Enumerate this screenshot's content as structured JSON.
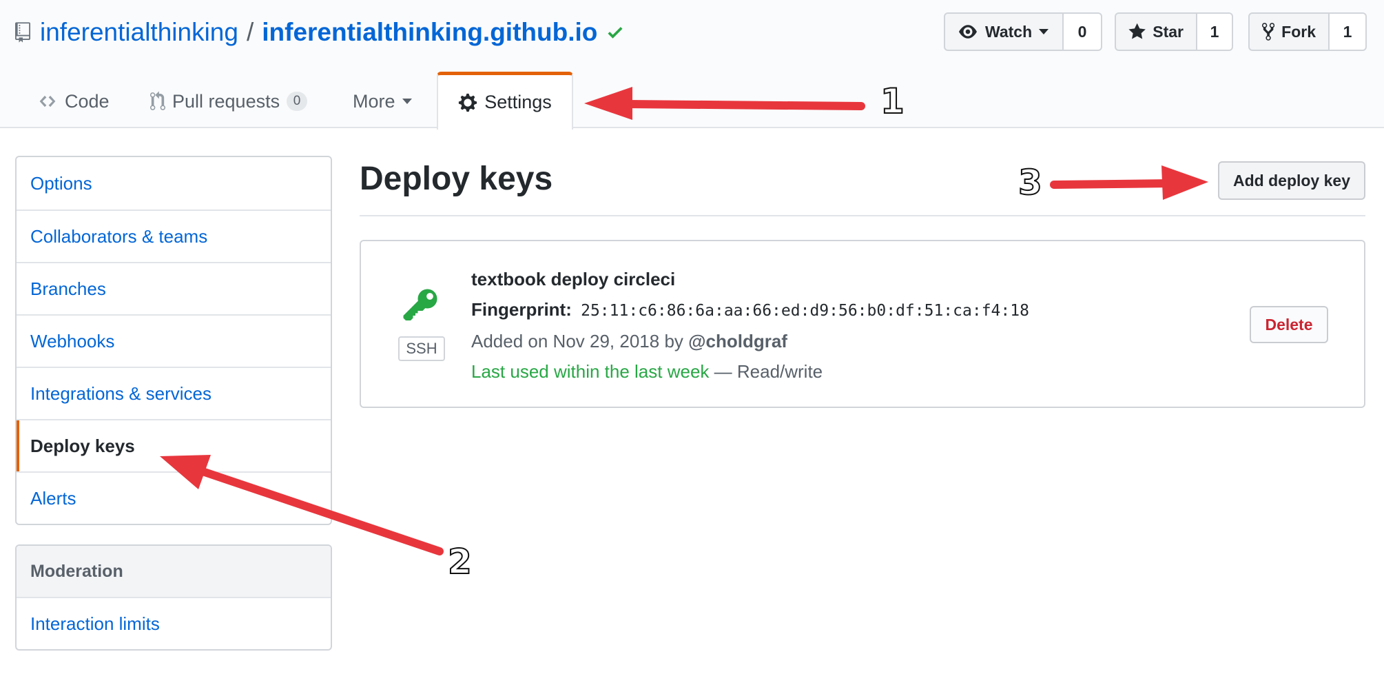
{
  "repo": {
    "owner": "inferentialthinking",
    "separator": "/",
    "name": "inferentialthinking.github.io"
  },
  "actions": {
    "watch": {
      "label": "Watch",
      "count": "0"
    },
    "star": {
      "label": "Star",
      "count": "1"
    },
    "fork": {
      "label": "Fork",
      "count": "1"
    }
  },
  "tabs": {
    "code": "Code",
    "pulls": {
      "label": "Pull requests",
      "count": "0"
    },
    "more": "More",
    "settings": "Settings"
  },
  "sidebar": {
    "items": [
      {
        "label": "Options"
      },
      {
        "label": "Collaborators & teams"
      },
      {
        "label": "Branches"
      },
      {
        "label": "Webhooks"
      },
      {
        "label": "Integrations & services"
      },
      {
        "label": "Deploy keys",
        "selected": true
      },
      {
        "label": "Alerts"
      }
    ],
    "moderation": {
      "heading": "Moderation",
      "items": [
        {
          "label": "Interaction limits"
        }
      ]
    }
  },
  "main": {
    "title": "Deploy keys",
    "add_button": "Add deploy key",
    "key": {
      "type": "SSH",
      "title": "textbook deploy circleci",
      "fingerprint_label": "Fingerprint:",
      "fingerprint": "25:11:c6:86:6a:aa:66:ed:d9:56:b0:df:51:ca:f4:18",
      "added_prefix": "Added on Nov 29, 2018 by",
      "added_user": "@choldgraf",
      "last_used": "Last used within the last week",
      "access": " — Read/write",
      "delete_button": "Delete"
    }
  },
  "annotations": {
    "one": "1",
    "two": "2",
    "three": "3"
  },
  "colors": {
    "link": "#0366d6",
    "accent_tab": "#e36209",
    "success": "#28a745",
    "danger": "#cb2431",
    "annotation_arrow": "#e8363d"
  }
}
